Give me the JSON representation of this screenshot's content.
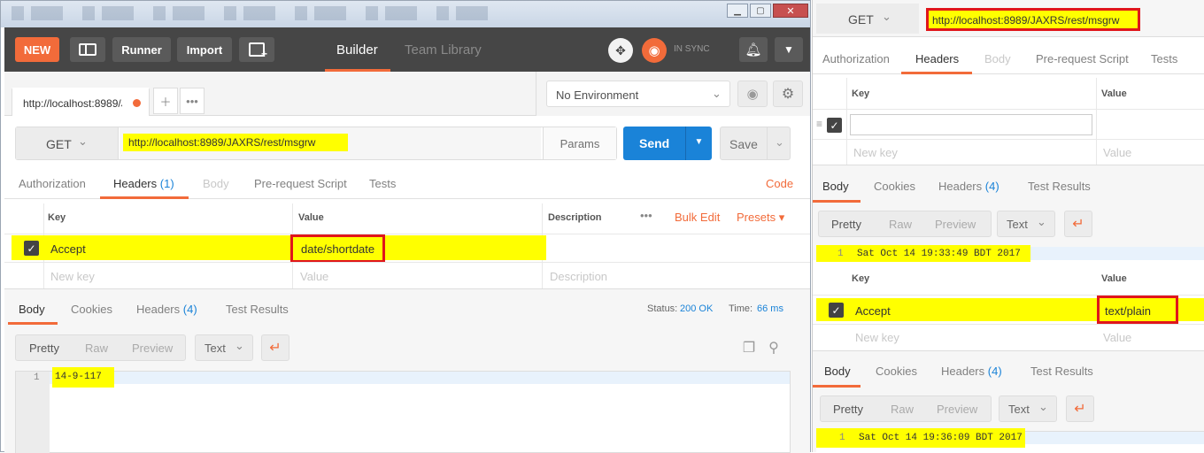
{
  "left": {
    "topbar": {
      "new_label": "NEW",
      "runner_label": "Runner",
      "import_label": "Import",
      "builder_label": "Builder",
      "team_library_label": "Team Library",
      "sync_label": "IN SYNC"
    },
    "tab": {
      "url_label": "http://localhost:8989/J"
    },
    "environment": {
      "label": "No Environment"
    },
    "request": {
      "method": "GET",
      "url": "http://localhost:8989/JAXRS/rest/msgrw",
      "params_label": "Params",
      "send_label": "Send",
      "save_label": "Save"
    },
    "req_tabs": {
      "authorization": "Authorization",
      "headers": "Headers",
      "headers_count": "(1)",
      "body": "Body",
      "prerequest": "Pre-request Script",
      "tests": "Tests",
      "code": "Code"
    },
    "headers_table": {
      "col_key": "Key",
      "col_value": "Value",
      "col_description": "Description",
      "bulk_edit": "Bulk Edit",
      "presets": "Presets",
      "row_key": "Accept",
      "row_value": "date/shortdate",
      "ph_key": "New key",
      "ph_value": "Value",
      "ph_description": "Description"
    },
    "resp_tabs": {
      "body": "Body",
      "cookies": "Cookies",
      "headers": "Headers",
      "headers_count": "(4)",
      "test_results": "Test Results",
      "status_label": "Status:",
      "status_value": "200 OK",
      "time_label": "Time:",
      "time_value": "66 ms"
    },
    "view": {
      "pretty": "Pretty",
      "raw": "Raw",
      "preview": "Preview",
      "format": "Text"
    },
    "response": {
      "line": "1",
      "text": "14-9-117"
    }
  },
  "right": {
    "request": {
      "method": "GET",
      "url": "http://localhost:8989/JAXRS/rest/msgrw"
    },
    "req_tabs": {
      "authorization": "Authorization",
      "headers": "Headers",
      "body": "Body",
      "prerequest": "Pre-request Script",
      "tests": "Tests"
    },
    "headers_table": {
      "col_key": "Key",
      "col_value": "Value",
      "ph_key": "New key",
      "ph_value": "Value"
    },
    "resp1": {
      "tabs": {
        "body": "Body",
        "cookies": "Cookies",
        "headers": "Headers",
        "headers_count": "(4)",
        "test_results": "Test Results"
      },
      "view": {
        "pretty": "Pretty",
        "raw": "Raw",
        "preview": "Preview",
        "format": "Text"
      },
      "line": "1",
      "text": "Sat Oct 14 19:33:49 BDT 2017"
    },
    "headers_table2": {
      "col_key": "Key",
      "col_value": "Value",
      "row_key": "Accept",
      "row_value": "text/plain",
      "ph_key": "New key",
      "ph_value": "Value"
    },
    "resp2": {
      "tabs": {
        "body": "Body",
        "cookies": "Cookies",
        "headers": "Headers",
        "headers_count": "(4)",
        "test_results": "Test Results"
      },
      "view": {
        "pretty": "Pretty",
        "raw": "Raw",
        "preview": "Preview",
        "format": "Text"
      },
      "line": "1",
      "text": "Sat Oct 14 19:36:09 BDT 2017"
    }
  }
}
